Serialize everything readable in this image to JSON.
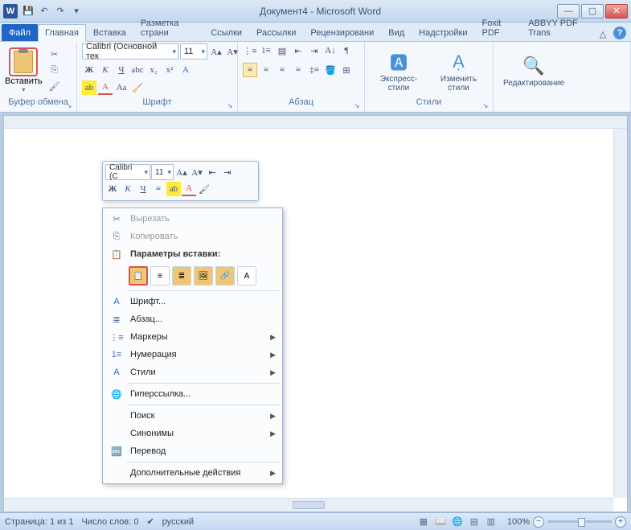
{
  "title": "Документ4 - Microsoft Word",
  "tabs": {
    "file": "Файл",
    "home": "Главная",
    "insert": "Вставка",
    "layout": "Разметка страни",
    "refs": "Ссылки",
    "mail": "Рассылки",
    "review": "Рецензировани",
    "view": "Вид",
    "addins": "Надстройки",
    "foxit": "Foxit PDF",
    "abbyy": "ABBYY PDF Trans"
  },
  "ribbon": {
    "paste": "Вставить",
    "clipboard_group": "Буфер обмена",
    "font_group": "Шрифт",
    "para_group": "Абзац",
    "styles_group": "Стили",
    "edit_group": "Редактирование",
    "font_name": "Calibri (Основной тек",
    "font_size": "11",
    "express_styles": "Экспресс-стили",
    "change_styles": "Изменить стили"
  },
  "minibar": {
    "font": "Calibri (С",
    "size": "11"
  },
  "ctx": {
    "cut": "Вырезать",
    "copy": "Копировать",
    "paste_header": "Параметры вставки:",
    "font": "Шрифт...",
    "para": "Абзац...",
    "bullets": "Маркеры",
    "numbering": "Нумерация",
    "styles": "Стили",
    "hyperlink": "Гиперссылка...",
    "search": "Поиск",
    "synonyms": "Синонимы",
    "translate": "Перевод",
    "extra": "Дополнительные действия"
  },
  "status": {
    "page": "Страница: 1 из 1",
    "words": "Число слов: 0",
    "lang": "русский",
    "zoom": "100%"
  }
}
